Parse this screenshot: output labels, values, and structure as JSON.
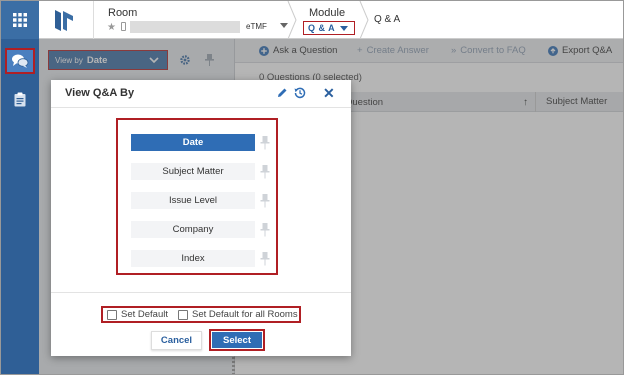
{
  "header": {
    "room_label": "Room",
    "room_tag": "eTMF",
    "module_label": "Module",
    "module_value": "Q & A",
    "crumb": "Q & A"
  },
  "sidebar": {
    "view_by_prefix": "View by",
    "view_by_value": "Date"
  },
  "toolbar": {
    "ask": "Ask a Question",
    "create": "Create Answer",
    "convert": "Convert to FAQ",
    "export": "Export Q&A"
  },
  "list": {
    "count": "0 Questions (0 selected)",
    "col_question": "Question",
    "col_sort": "↑",
    "col_subject": "Subject Matter"
  },
  "dialog": {
    "title": "View Q&A By",
    "options": [
      {
        "label": "Date",
        "selected": true
      },
      {
        "label": "Subject Matter",
        "selected": false
      },
      {
        "label": "Issue Level",
        "selected": false
      },
      {
        "label": "Company",
        "selected": false
      },
      {
        "label": "Index",
        "selected": false
      }
    ],
    "set_default": "Set Default",
    "set_default_all": "Set Default for all Rooms",
    "cancel": "Cancel",
    "select": "Select"
  },
  "icons": {
    "grid": "grid-icon",
    "logo": "app-logo",
    "star": "star-icon",
    "phone": "mobile-icon",
    "qa": "chat-bubbles-icon",
    "clipboard": "clipboard-icon",
    "gear": "gear-icon",
    "pin": "pin-icon",
    "edit": "pencil-icon",
    "history": "history-icon",
    "close": "close-icon"
  },
  "colors": {
    "brand": "#2f6db5",
    "rail": "#2f5f96",
    "highlight": "#b01f24"
  }
}
